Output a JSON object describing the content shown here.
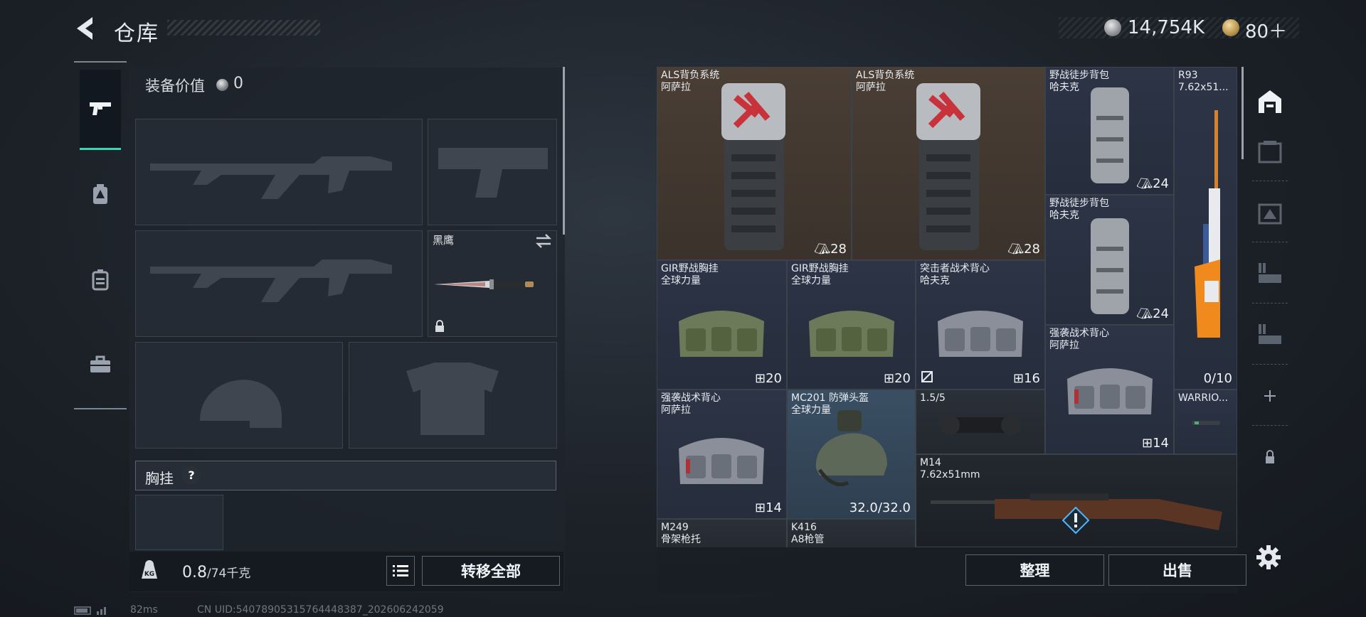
{
  "header": {
    "title": "仓库",
    "currency_silver": "14,754K",
    "currency_gold": "80＋"
  },
  "sidebar": {
    "items": [
      {
        "icon": "pistol-icon",
        "active": true
      },
      {
        "icon": "backpack-badge-icon",
        "active": false
      },
      {
        "icon": "vest-icon",
        "active": false
      },
      {
        "icon": "toolbox-icon",
        "active": false
      }
    ]
  },
  "equipment": {
    "value_label": "装备价值",
    "value": "0",
    "knife_name": "黑鹰",
    "chest_label": "胸挂",
    "chest_help": "?",
    "weight_current": "0.8",
    "weight_max": "/74千克",
    "transfer_all": "转移全部"
  },
  "inventory": {
    "items": [
      {
        "id": "als1",
        "name": "ALS背负系统\n阿萨拉",
        "count": "28"
      },
      {
        "id": "als2",
        "name": "ALS背负系统\n阿萨拉",
        "count": "28"
      },
      {
        "id": "yz1",
        "name": "野战徒步背包\n哈夫克",
        "count": "24"
      },
      {
        "id": "r93",
        "name": "R93\n7.62x51...",
        "count": "0/10"
      },
      {
        "id": "yz2",
        "name": "野战徒步背包\n哈夫克",
        "count": "24"
      },
      {
        "id": "gir1",
        "name": "GIR野战胸挂\n全球力量",
        "count": "20"
      },
      {
        "id": "gir2",
        "name": "GIR野战胸挂\n全球力量",
        "count": "20"
      },
      {
        "id": "tjz",
        "name": "突击者战术背心\n哈夫克",
        "count": "16"
      },
      {
        "id": "qx1",
        "name": "强袭战术背心\n阿萨拉",
        "count": "14"
      },
      {
        "id": "qx2",
        "name": "强袭战术背心\n阿萨拉",
        "count": "14"
      },
      {
        "id": "mc201",
        "name": "MC201 防弹头盔\n全球力量",
        "count": "32.0/32.0"
      },
      {
        "id": "scope",
        "name": "1.5/5",
        "count": ""
      },
      {
        "id": "warrior",
        "name": "WARRIO...",
        "count": ""
      },
      {
        "id": "m14",
        "name": "M14\n7.62x51mm",
        "count": ""
      },
      {
        "id": "m249",
        "name": "M249\n骨架枪托",
        "count": ""
      },
      {
        "id": "k416",
        "name": "K416\nA8枪管",
        "count": ""
      }
    ],
    "sort_label": "整理",
    "sell_label": "出售"
  },
  "status": {
    "ping": "82ms",
    "uid": "CN UID:54078905315764448387_202606242059"
  },
  "colors": {
    "accent": "#3fd3b4",
    "bag_brown": "#4a3e35",
    "cell_navy": "#2c3446"
  }
}
